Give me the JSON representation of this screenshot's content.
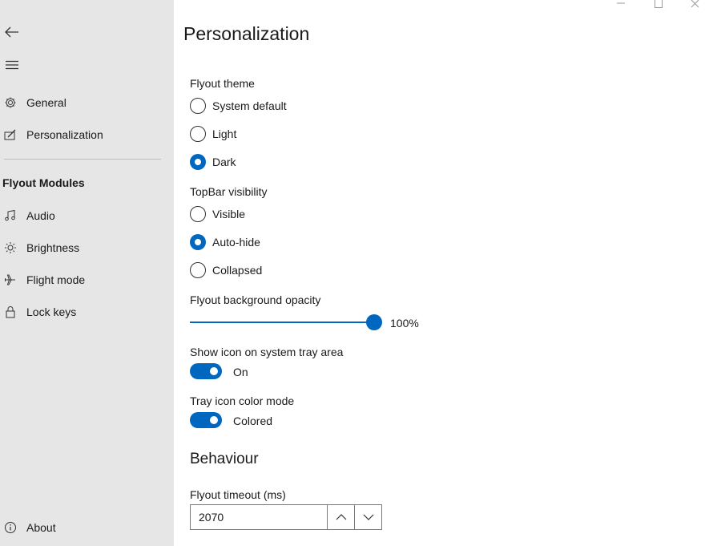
{
  "window": {
    "title_buttons": [
      "minimize",
      "maximize",
      "close"
    ]
  },
  "sidebar": {
    "back_icon": "back-arrow-icon",
    "menu_icon": "hamburger-icon",
    "items": [
      {
        "label": "General",
        "icon": "gear-icon"
      },
      {
        "label": "Personalization",
        "icon": "personalization-icon"
      }
    ],
    "modules_title": "Flyout Modules",
    "modules": [
      {
        "label": "Audio",
        "icon": "music-icon"
      },
      {
        "label": "Brightness",
        "icon": "brightness-icon"
      },
      {
        "label": "Flight mode",
        "icon": "airplane-icon"
      },
      {
        "label": "Lock keys",
        "icon": "lock-icon"
      }
    ],
    "about": {
      "label": "About",
      "icon": "info-icon"
    }
  },
  "main": {
    "title": "Personalization",
    "flyout_theme": {
      "label": "Flyout theme",
      "options": [
        "System default",
        "Light",
        "Dark"
      ],
      "selected": "Dark"
    },
    "topbar_visibility": {
      "label": "TopBar visibility",
      "options": [
        "Visible",
        "Auto-hide",
        "Collapsed"
      ],
      "selected": "Auto-hide"
    },
    "opacity": {
      "label": "Flyout background opacity",
      "value": 100,
      "value_text": "100%"
    },
    "tray_icon": {
      "label": "Show icon on system tray area",
      "on": true,
      "state_text": "On"
    },
    "tray_color": {
      "label": "Tray icon color mode",
      "on": true,
      "state_text": "Colored"
    },
    "behaviour_header": "Behaviour",
    "timeout": {
      "label": "Flyout timeout (ms)",
      "value": "2070"
    }
  },
  "colors": {
    "accent": "#0067c0",
    "sidebar_bg": "#e6e6e6"
  }
}
